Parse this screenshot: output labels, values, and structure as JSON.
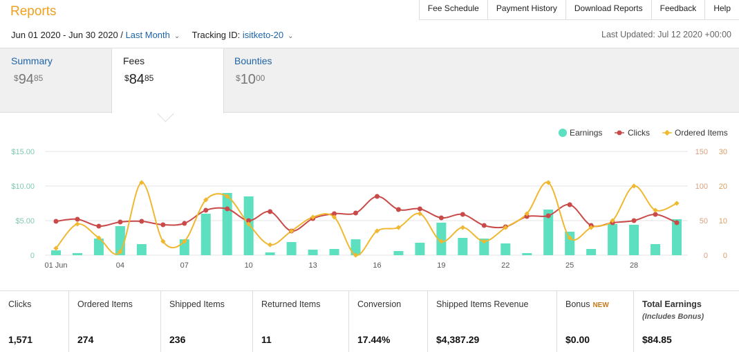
{
  "header": {
    "title": "Reports",
    "nav": [
      "Fee Schedule",
      "Payment History",
      "Download Reports",
      "Feedback",
      "Help"
    ],
    "date_range": "Jun 01 2020 - Jun 30 2020",
    "separator": "/",
    "date_preset": "Last Month",
    "tracking_label": "Tracking ID:",
    "tracking_id": "isitketo-20",
    "last_updated": "Last Updated: Jul 12 2020 +00:00"
  },
  "tabs": {
    "summary": {
      "label": "Summary",
      "currency": "$",
      "whole": "94",
      "cents": "85"
    },
    "fees": {
      "label": "Fees",
      "currency": "$",
      "whole": "84",
      "cents": "85"
    },
    "bounties": {
      "label": "Bounties",
      "currency": "$",
      "whole": "10",
      "cents": "00"
    }
  },
  "colors": {
    "earnings": "#5ce0c0",
    "clicks": "#c94a48",
    "ordered": "#f0b830"
  },
  "chart_data": {
    "type": "bar+line",
    "legend": [
      "Earnings",
      "Clicks",
      "Ordered Items"
    ],
    "legend_position": "top-right",
    "x_ticks": [
      "01 Jun",
      "04",
      "07",
      "10",
      "13",
      "16",
      "19",
      "22",
      "25",
      "28"
    ],
    "y_left_ticks": [
      "$15.00",
      "$10.00",
      "$5.00",
      "0"
    ],
    "y_mid_ticks": [
      "150",
      "100",
      "50",
      "0"
    ],
    "y_right_ticks": [
      "30",
      "20",
      "10",
      "0"
    ],
    "y_left_range": [
      0,
      15
    ],
    "y_mid_range": [
      0,
      150
    ],
    "y_right_range": [
      0,
      30
    ],
    "days": [
      1,
      2,
      3,
      4,
      5,
      6,
      7,
      8,
      9,
      10,
      11,
      12,
      13,
      14,
      15,
      16,
      17,
      18,
      19,
      20,
      21,
      22,
      23,
      24,
      25,
      26,
      27,
      28,
      29,
      30
    ],
    "earnings": [
      0.7,
      0.3,
      2.4,
      4.2,
      1.6,
      0,
      2.3,
      6.0,
      9.0,
      8.5,
      0.4,
      1.9,
      0.8,
      0.9,
      2.3,
      0,
      0.6,
      1.8,
      4.7,
      2.5,
      2.4,
      1.7,
      0.3,
      6.6,
      3.4,
      0.9,
      4.5,
      4.4,
      1.6,
      5.2
    ],
    "clicks": [
      49,
      52,
      42,
      48,
      49,
      44,
      46,
      65,
      67,
      50,
      63,
      35,
      53,
      60,
      61,
      85,
      66,
      67,
      54,
      59,
      43,
      41,
      56,
      57,
      73,
      43,
      47,
      50,
      59,
      47
    ],
    "ordered_items": [
      2,
      9,
      5,
      1,
      21,
      4,
      4,
      16,
      17,
      9,
      3,
      7,
      11,
      11,
      0,
      7,
      8,
      12,
      4,
      8,
      4,
      8,
      12,
      21,
      5,
      8,
      10,
      20,
      13,
      15
    ]
  },
  "stats": [
    {
      "label": "Clicks",
      "value": "1,571"
    },
    {
      "label": "Ordered Items",
      "value": "274"
    },
    {
      "label": "Shipped Items",
      "value": "236"
    },
    {
      "label": "Returned Items",
      "value": "11"
    },
    {
      "label": "Conversion",
      "value": "17.44%"
    },
    {
      "label": "Shipped Items Revenue",
      "value": "$4,387.29"
    },
    {
      "label": "Bonus",
      "badge": "NEW",
      "value": "$0.00"
    },
    {
      "label": "Total Earnings",
      "sub": "(Includes Bonus)",
      "value": "$84.85"
    }
  ]
}
